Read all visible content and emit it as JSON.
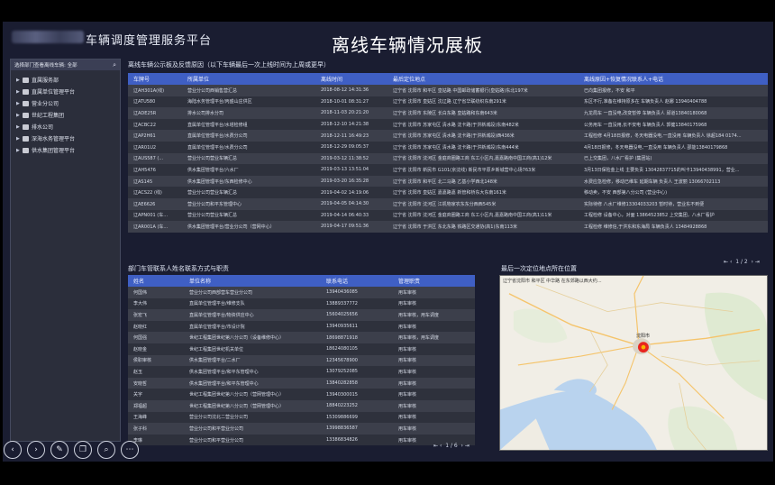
{
  "header": {
    "app_title": "车辆调度管理服务平台",
    "page_title": "离线车辆情况展板"
  },
  "sidebar": {
    "search_text": "选择部门查看离线车辆: 全部",
    "items": [
      {
        "label": "直属服务部"
      },
      {
        "label": "直属单位管理平台"
      },
      {
        "label": "营业分公司"
      },
      {
        "label": "世纪工程集团"
      },
      {
        "label": "排水公司"
      },
      {
        "label": "深海水务管理平台"
      },
      {
        "label": "供水集团管理平台"
      }
    ]
  },
  "vehicle_section": {
    "title": "离线车辆公示板及反馈原因（以下车辆最后一次上线时间为上周或更早）",
    "columns": [
      "车牌号",
      "所属单位",
      "离线时间",
      "最后定位地点",
      "离线原因+恢复情况联系人+电话"
    ],
    "rows": [
      [
        "辽AH301A(线)",
        "营业分公司西销售营汇总",
        "2018-08-12 14:31:36",
        "辽宁省 沈阳市 和平区 皇姑路 中国邮政储蓄银行(皇姑路)东北197米",
        "已向集团报修，不安 和平"
      ],
      [
        "辽ATU580",
        "海陆水务管理平台/丙盛山庄供区",
        "2018-10-01 08:31:27",
        "辽宁省 沈阳市 皇姑区 沈辽路 辽宁省华联纺织东南291米",
        "东区不行,准备在维持原多在 车辆负责人 赵娜 13940404788"
      ],
      [
        "辽ADE25R",
        "排水公司排水分司",
        "2018-11-03 20:21:20",
        "辽宁省 沈阳市 东陵区 长白东路 皇姑路和东南643米",
        "九龙局车 一直没电,改变暂停 车辆负责人 邱道13840180068"
      ],
      [
        "辽ACBC22",
        "直属单位管理平台/水塔检修组",
        "2018-12-10 14:21:38",
        "辽宁省 沈阳市 苏家屯区 清水路 沈卡路(于洪新城段)东南482米",
        "公务用车 一直没用,长不安电 车辆负责人 郭健13840175968"
      ],
      [
        "辽AP2H61",
        "直属单位管理平台/水费分公司",
        "2018-12-11 16:49:23",
        "辽宁省 沈阳市 苏家屯区 清水路 沈卡路(于洪新城段)西436米",
        "工程检修 4月18日报修，冬天电器没电,一直没用 车辆负责人 徐超184 0174..."
      ],
      [
        "辽AR01U2",
        "直属单位管理平台/水费分公司",
        "2018-12-29 09:05:37",
        "辽宁省 沈阳市 苏家屯区 清水路 沈卡路(于洪新城段)东南444米",
        "4月18日报修，冬天电器没电,一直没用 车辆负责人 邵能13840179868"
      ],
      [
        "辽AUS587 (...",
        "营业分公司营业车辆汇总",
        "2019-03-12 11:38:52",
        "辽宁省 沈阳市 沈河区 金庭商圈路工商 东工小区内,嘉嘉路南中国工商(高1)12米",
        "已上交集团，八水厂看护 (集团站)"
      ],
      [
        "辽AH5476",
        "供水集团管理平台/六水厂",
        "2019-03-13 13:51:04",
        "辽宁省 沈阳市 新民市 G101(京沈线) 新民市平原乡新城营中心场763米",
        "3月13日保险金上线 主要负责 13042837715的叫卡13940438991，营业..."
      ],
      [
        "辽AS145",
        "供水集团管理平台/东西检修中心",
        "2019-03-20 16:35:28",
        "辽宁省 沈阳市 和平区 北二马路 乙基小学西北148米",
        "水费应急检修，移动已维车 延期车辆 负责人 王波丽 13066702113"
      ],
      [
        "辽ACS22 (线)",
        "营业分公司营业车辆汇总",
        "2019-04-02 14:19:06",
        "辽宁省 沈阳市 皇姑区 嘉嘉路嘉 新管和桥东大东南161米",
        "移动卖，不安 西部第八分公司 (营业中心)"
      ],
      [
        "辽AE6626",
        "营业分公司和平东管理中心",
        "2019-04-05 04:14:30",
        "辽宁省 沈阳市 沈河区 江机物家农东东分西西545米",
        "实际待修 八水厂维修13304033203 暂时待，营业东不到便"
      ],
      [
        "辽APN001 (车...",
        "营业分公司营业车辆汇总",
        "2019-04-14 06:40:33",
        "辽宁省 沈阳市 沈河区 金庭商圈路工商 东工小区内,嘉嘉路南中国工商(高1)11米",
        "工程检修 设备中心，对面 13864523852 上交集团，八水厂看护"
      ],
      [
        "辽AR001A (车...",
        "供水集团管理平台/营业分公司（营网中心）",
        "2019-04-17 09:51:36",
        "辽宁省 沈阳市 于洪区 东北东路 铁路区交通协(高1)东南113米",
        "工程检修 维修信,于洪东和东海局 车辆负责人 13484928868"
      ]
    ],
    "pager": {
      "first": "⇤",
      "prev": "‹",
      "current": "1",
      "sep": "/",
      "total": "2",
      "next": "›",
      "last": "⇥"
    }
  },
  "contacts_section": {
    "title": "部门车管联系人姓名联系方式与职责",
    "columns": [
      "姓名",
      "单位名称",
      "联系电话",
      "管理职责"
    ],
    "rows": [
      [
        "何国伟",
        "营业分公司西部营车营业分公司",
        "13940436085",
        "用车审核"
      ],
      [
        "李大伟",
        "直属单位管理平台/维修支队",
        "13889337772",
        "用车审核"
      ],
      [
        "张宏飞",
        "直属单位管理平台/物资供应中心",
        "15604025656",
        "用车审核，用车调度"
      ],
      [
        "赵晓红",
        "直属单位管理平台/市设计院",
        "13940935611",
        "用车审核"
      ],
      [
        "何国强",
        "世纪工程集团世纪第八分公司（设备维修中心）",
        "18698871918",
        "用车审核，用车调度"
      ],
      [
        "赵晓金",
        "世纪工程集团世纪机关单位",
        "18624080105",
        "用车审核"
      ],
      [
        "侯职审核",
        "供水集团管理平台/二水厂",
        "12345678900",
        "用车审核"
      ],
      [
        "赵玉",
        "供水集团管理平台/和平东管理中心",
        "13079252085",
        "用车审核"
      ],
      [
        "安晓哲",
        "供水集团管理平台/和平东管理中心",
        "13840282858",
        "用车审核"
      ],
      [
        "关宇",
        "世纪工程集团世纪第八分公司（营网管理中心）",
        "13940300015",
        "用车审核"
      ],
      [
        "郑福超",
        "世纪工程集团世纪第八分公司（营网管理中心）",
        "18840223252",
        "用车审核"
      ],
      [
        "王海峰",
        "营业分公司沈北二营业分公司",
        "15309886699",
        "用车审核"
      ],
      [
        "张子科",
        "营业分公司和平营业分公司",
        "13998836587",
        "用车审核"
      ],
      [
        "李琳",
        "营业分公司和平营业分公司",
        "13386834826",
        "用车审核"
      ]
    ],
    "pager": {
      "first": "⇤",
      "prev": "‹",
      "current": "1",
      "sep": "/",
      "total": "6",
      "next": "›",
      "last": "⇥"
    }
  },
  "map_section": {
    "title": "最后一次定位地点所在位置",
    "map_label": "辽宁省沈阳市 和平区 中华路 在东郊路以西大约...",
    "city_label": "沈阳市"
  },
  "toolbar": {
    "buttons": [
      {
        "name": "back-button",
        "icon": "‹"
      },
      {
        "name": "forward-button",
        "icon": "›"
      },
      {
        "name": "pen-button",
        "icon": "✎"
      },
      {
        "name": "window-button",
        "icon": "❐"
      },
      {
        "name": "zoom-button",
        "icon": "⌕"
      },
      {
        "name": "more-button",
        "icon": "⋯"
      }
    ]
  },
  "colors": {
    "header_bar": "#3f5fc4",
    "background": "#1a1d31",
    "row_odd": "#3c3f4b",
    "row_even": "#2e313c",
    "marker": "#e8251f"
  }
}
